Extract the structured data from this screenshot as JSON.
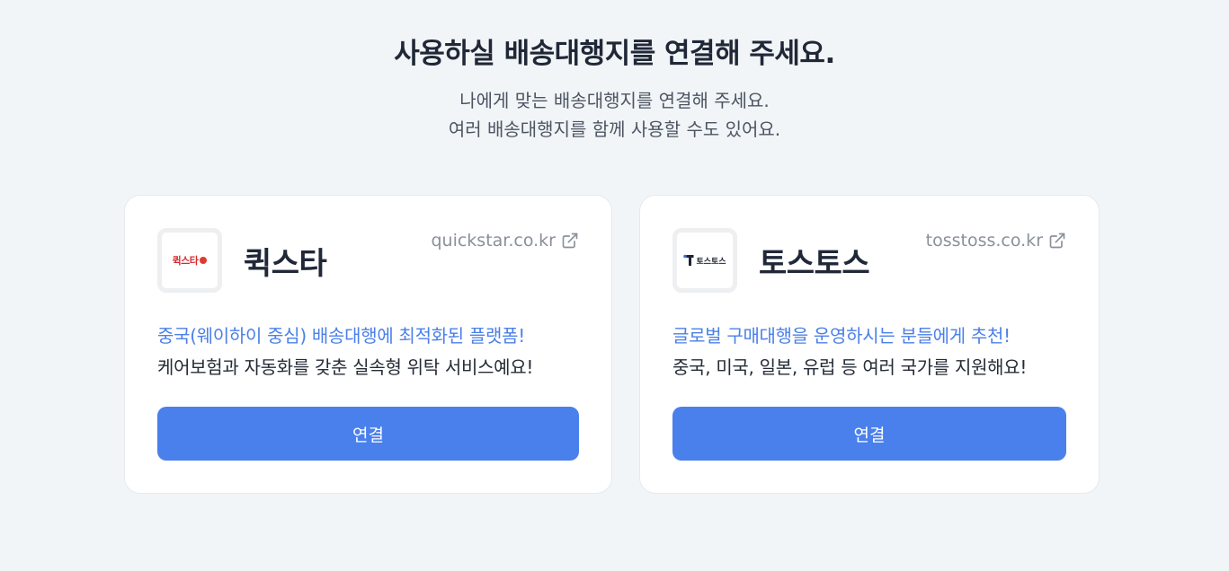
{
  "header": {
    "title": "사용하실 배송대행지를 연결해 주세요.",
    "subtitle_line1": "나에게 맞는 배송대행지를 연결해 주세요.",
    "subtitle_line2": "여러 배송대행지를 함께 사용할 수도 있어요."
  },
  "cards": [
    {
      "name": "퀵스타",
      "logo_text": "퀵스타",
      "link": "quickstar.co.kr",
      "link_icon": "external-link-icon",
      "desc_accent": "중국(웨이하이 중심) 배송대행에 최적화된 플랫폼!",
      "desc_plain": "케어보험과 자동화를 갖춘 실속형 위탁 서비스예요!",
      "button_label": "연결"
    },
    {
      "name": "토스토스",
      "logo_text": "토스토스",
      "link": "tosstoss.co.kr",
      "link_icon": "external-link-icon",
      "desc_accent": "글로벌 구매대행을 운영하시는 분들에게 추천!",
      "desc_plain": "중국, 미국, 일본, 유럽 등 여러 국가를 지원해요!",
      "button_label": "연결"
    }
  ],
  "colors": {
    "accent": "#4a80ec",
    "accent_text": "#4b80e8",
    "background": "#f2f5f7"
  }
}
